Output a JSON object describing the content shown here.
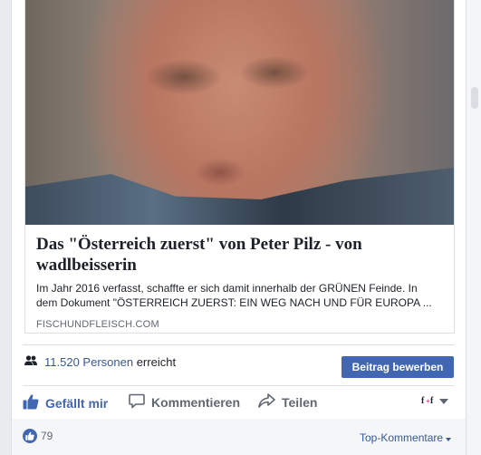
{
  "card": {
    "title": "Das \"Österreich zuerst\" von Peter Pilz - von wadlbeisserin",
    "description_line1": "Im Jahr 2016 verfasst, schaffte er sich damit innerhalb der GRÜNEN Feinde. In",
    "description_line2": "dem Dokument \"ÖSTERREICH ZUERST: EIN WEG NACH UND FÜR EUROPA ...",
    "domain": "FISCHUNDFLEISCH.COM"
  },
  "reach": {
    "count": "11.520",
    "people": "Personen",
    "suffix": "erreicht"
  },
  "promote_button": "Beitrag bewerben",
  "actions": {
    "like": "Gefällt mir",
    "comment": "Kommentieren",
    "share": "Teilen"
  },
  "footer": {
    "like_count": "79",
    "sort_label": "Top-Kommentare"
  },
  "colors": {
    "accent": "#4267b2",
    "link": "#365899",
    "muted": "#606770"
  },
  "icons": [
    "people-icon",
    "like-icon",
    "comment-icon",
    "share-icon",
    "page-avatar-icon",
    "dropdown-caret-icon",
    "like-badge-icon"
  ]
}
